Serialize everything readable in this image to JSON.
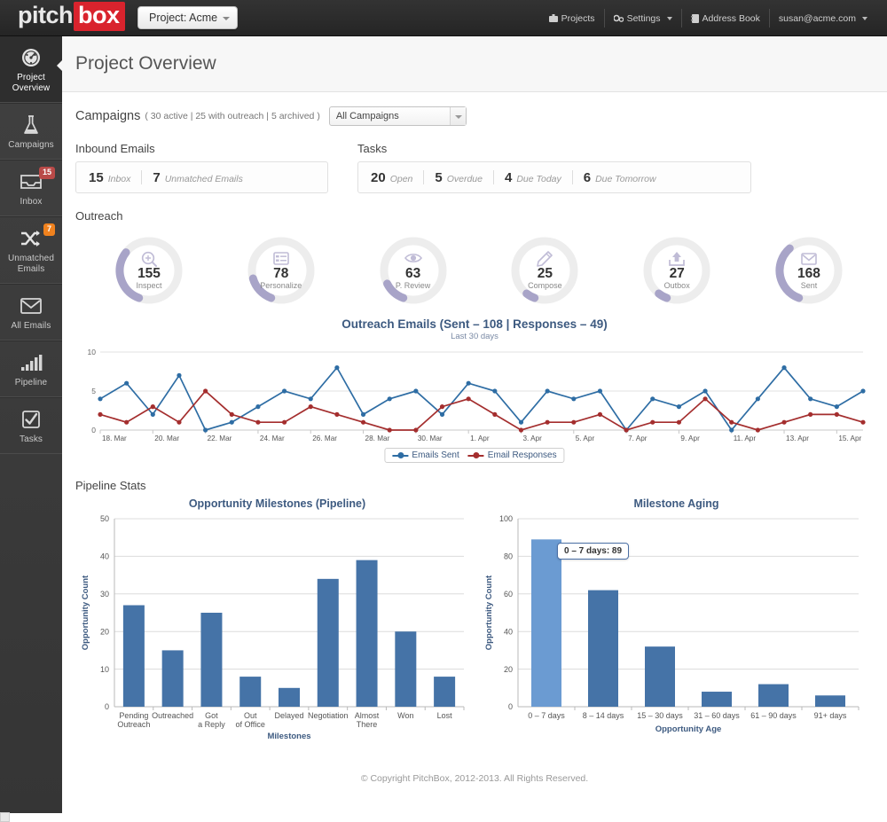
{
  "brand": {
    "part1": "pitch",
    "part2": "box"
  },
  "topbar": {
    "project_button": "Project: Acme",
    "nav": [
      {
        "label": "Projects",
        "icon": "briefcase-icon",
        "caret": false
      },
      {
        "label": "Settings",
        "icon": "gears-icon",
        "caret": true
      },
      {
        "label": "Address Book",
        "icon": "book-icon",
        "caret": false
      },
      {
        "label": "susan@acme.com",
        "icon": "none",
        "caret": true
      }
    ]
  },
  "sidebar": {
    "items": [
      {
        "label": "Project Overview",
        "icon": "dashboard-icon",
        "active": true,
        "badge": null
      },
      {
        "label": "Campaigns",
        "icon": "flask-icon",
        "active": false,
        "badge": null
      },
      {
        "label": "Inbox",
        "icon": "inbox-icon",
        "active": false,
        "badge": "15",
        "badge_color": "red"
      },
      {
        "label": "Unmatched Emails",
        "icon": "shuffle-icon",
        "active": false,
        "badge": "7",
        "badge_color": "orange"
      },
      {
        "label": "All Emails",
        "icon": "envelope-icon",
        "active": false,
        "badge": null
      },
      {
        "label": "Pipeline",
        "icon": "bar-chart-icon",
        "active": false,
        "badge": null
      },
      {
        "label": "Tasks",
        "icon": "checkbox-icon",
        "active": false,
        "badge": null
      }
    ]
  },
  "page": {
    "title": "Project Overview"
  },
  "campaigns": {
    "label": "Campaigns",
    "meta": "( 30 active | 25 with outreach | 5 archived )",
    "filter_value": "All Campaigns"
  },
  "inbound": {
    "title": "Inbound Emails",
    "items": [
      {
        "num": "15",
        "word": "Inbox"
      },
      {
        "num": "7",
        "word": "Unmatched Emails"
      }
    ]
  },
  "tasks": {
    "title": "Tasks",
    "items": [
      {
        "num": "20",
        "word": "Open"
      },
      {
        "num": "5",
        "word": "Overdue"
      },
      {
        "num": "4",
        "word": "Due Today"
      },
      {
        "num": "6",
        "word": "Due Tomorrow"
      }
    ]
  },
  "outreach": {
    "title": "Outreach",
    "accent": "#a8a4c8",
    "track": "#ededed",
    "donuts": [
      {
        "num": "155",
        "label": "Inspect",
        "icon": "magnifier-plus-icon",
        "pct": 30
      },
      {
        "num": "78",
        "label": "Personalize",
        "icon": "list-icon",
        "pct": 15
      },
      {
        "num": "63",
        "label": "P. Review",
        "icon": "eye-icon",
        "pct": 12
      },
      {
        "num": "25",
        "label": "Compose",
        "icon": "pencil-icon",
        "pct": 5
      },
      {
        "num": "27",
        "label": "Outbox",
        "icon": "upload-icon",
        "pct": 5
      },
      {
        "num": "168",
        "label": "Sent",
        "icon": "envelope-icon",
        "pct": 33
      }
    ]
  },
  "pipeline_stats": {
    "title": "Pipeline Stats"
  },
  "footer": {
    "text": "© Copyright PitchBox, 2012-2013. All Rights Reserved."
  },
  "chart_data": [
    {
      "type": "line",
      "title": "Outreach Emails (Sent – 108 | Responses – 49)",
      "subtitle": "Last 30 days",
      "xlabel": "",
      "ylabel": "",
      "ylim": [
        0,
        10
      ],
      "yticks": [
        0,
        5,
        10
      ],
      "grid": true,
      "legend_position": "bottom",
      "x": [
        "18. Mar",
        "19. Mar",
        "20. Mar",
        "21. Mar",
        "22. Mar",
        "23. Mar",
        "24. Mar",
        "25. Mar",
        "26. Mar",
        "27. Mar",
        "28. Mar",
        "29. Mar",
        "30. Mar",
        "31. Mar",
        "1. Apr",
        "2. Apr",
        "3. Apr",
        "4. Apr",
        "5. Apr",
        "6. Apr",
        "7. Apr",
        "8. Apr",
        "9. Apr",
        "10. Apr",
        "11. Apr",
        "12. Apr",
        "13. Apr",
        "14. Apr",
        "15. Apr",
        "16. Apr"
      ],
      "xticks": [
        "18. Mar",
        "20. Mar",
        "22. Mar",
        "24. Mar",
        "26. Mar",
        "28. Mar",
        "30. Mar",
        "1. Apr",
        "3. Apr",
        "5. Apr",
        "7. Apr",
        "9. Apr",
        "11. Apr",
        "13. Apr",
        "15. Apr"
      ],
      "series": [
        {
          "name": "Emails Sent",
          "color": "#2e6da4",
          "values": [
            4,
            6,
            2,
            7,
            0,
            1,
            3,
            5,
            4,
            8,
            2,
            4,
            5,
            2,
            6,
            5,
            1,
            5,
            4,
            5,
            0,
            4,
            3,
            5,
            0,
            4,
            8,
            4,
            3,
            5
          ]
        },
        {
          "name": "Email Responses",
          "color": "#a42e2e",
          "values": [
            2,
            1,
            3,
            1,
            5,
            2,
            1,
            1,
            3,
            2,
            1,
            0,
            0,
            3,
            4,
            2,
            0,
            1,
            1,
            2,
            0,
            1,
            1,
            4,
            1,
            0,
            1,
            2,
            2,
            1
          ]
        }
      ]
    },
    {
      "type": "bar",
      "title": "Opportunity Milestones (Pipeline)",
      "xlabel": "Milestones",
      "ylabel": "Opportunity Count",
      "ylim": [
        0,
        50
      ],
      "yticks": [
        0,
        10,
        20,
        30,
        40,
        50
      ],
      "grid": true,
      "bar_color": "#4573a7",
      "categories": [
        "Pending Outreach",
        "Outreached",
        "Got a Reply",
        "Out of Office",
        "Delayed",
        "Negotiation",
        "Almost There",
        "Won",
        "Lost"
      ],
      "values": [
        27,
        15,
        25,
        8,
        5,
        34,
        39,
        20,
        8
      ]
    },
    {
      "type": "bar",
      "title": "Milestone Aging",
      "xlabel": "Opportunity Age",
      "ylabel": "Opportunity Count",
      "ylim": [
        0,
        100
      ],
      "yticks": [
        0,
        20,
        40,
        60,
        80,
        100
      ],
      "grid": true,
      "bar_color": "#4573a7",
      "highlight_color": "#6b9bd2",
      "highlight_index": 0,
      "tooltip": "0 – 7 days: 89",
      "categories": [
        "0 – 7 days",
        "8 – 14 days",
        "15 – 30 days",
        "31 – 60 days",
        "61 – 90 days",
        "91+ days"
      ],
      "values": [
        89,
        62,
        32,
        8,
        12,
        6
      ]
    }
  ]
}
